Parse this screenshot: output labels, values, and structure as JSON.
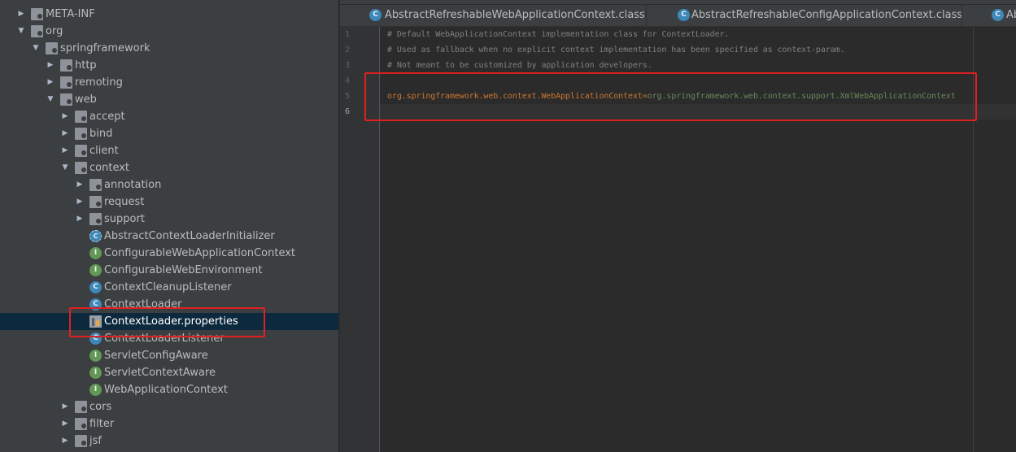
{
  "tree": {
    "items": [
      {
        "label": "META-INF",
        "indent": 0,
        "expanded": false,
        "icon": "folder-icon",
        "kind": "folder"
      },
      {
        "label": "org",
        "indent": 0,
        "expanded": true,
        "icon": "folder-icon",
        "kind": "folder"
      },
      {
        "label": "springframework",
        "indent": 1,
        "expanded": true,
        "icon": "folder-icon",
        "kind": "folder"
      },
      {
        "label": "http",
        "indent": 2,
        "expanded": false,
        "icon": "folder-icon",
        "kind": "folder"
      },
      {
        "label": "remoting",
        "indent": 2,
        "expanded": false,
        "icon": "folder-icon",
        "kind": "folder"
      },
      {
        "label": "web",
        "indent": 2,
        "expanded": true,
        "icon": "folder-icon",
        "kind": "folder"
      },
      {
        "label": "accept",
        "indent": 3,
        "expanded": false,
        "icon": "folder-icon",
        "kind": "folder"
      },
      {
        "label": "bind",
        "indent": 3,
        "expanded": false,
        "icon": "folder-icon",
        "kind": "folder"
      },
      {
        "label": "client",
        "indent": 3,
        "expanded": false,
        "icon": "folder-icon",
        "kind": "folder"
      },
      {
        "label": "context",
        "indent": 3,
        "expanded": true,
        "icon": "folder-icon",
        "kind": "folder"
      },
      {
        "label": "annotation",
        "indent": 4,
        "expanded": false,
        "icon": "folder-icon",
        "kind": "folder"
      },
      {
        "label": "request",
        "indent": 4,
        "expanded": false,
        "icon": "folder-icon",
        "kind": "folder"
      },
      {
        "label": "support",
        "indent": 4,
        "expanded": false,
        "icon": "folder-icon",
        "kind": "folder"
      },
      {
        "label": "AbstractContextLoaderInitializer",
        "indent": 4,
        "icon": "abstract-class-icon",
        "kind": "abstract"
      },
      {
        "label": "ConfigurableWebApplicationContext",
        "indent": 4,
        "icon": "interface-icon",
        "kind": "interface"
      },
      {
        "label": "ConfigurableWebEnvironment",
        "indent": 4,
        "icon": "interface-icon",
        "kind": "interface"
      },
      {
        "label": "ContextCleanupListener",
        "indent": 4,
        "icon": "class-icon",
        "kind": "class"
      },
      {
        "label": "ContextLoader",
        "indent": 4,
        "icon": "class-icon",
        "kind": "class"
      },
      {
        "label": "ContextLoader.properties",
        "indent": 4,
        "icon": "properties-file-icon",
        "kind": "properties",
        "selected": true
      },
      {
        "label": "ContextLoaderListener",
        "indent": 4,
        "icon": "class-icon",
        "kind": "class"
      },
      {
        "label": "ServletConfigAware",
        "indent": 4,
        "icon": "interface-icon",
        "kind": "interface"
      },
      {
        "label": "ServletContextAware",
        "indent": 4,
        "icon": "interface-icon",
        "kind": "interface"
      },
      {
        "label": "WebApplicationContext",
        "indent": 4,
        "icon": "interface-icon",
        "kind": "interface"
      },
      {
        "label": "cors",
        "indent": 3,
        "expanded": false,
        "icon": "folder-icon",
        "kind": "folder"
      },
      {
        "label": "filter",
        "indent": 3,
        "expanded": false,
        "icon": "folder-icon",
        "kind": "folder"
      },
      {
        "label": "jsf",
        "indent": 3,
        "expanded": false,
        "icon": "folder-icon",
        "kind": "folder"
      }
    ]
  },
  "tabs": [
    {
      "label": "AbstractRefreshableWebApplicationContext.class",
      "icon": "class-file-icon"
    },
    {
      "label": "AbstractRefreshableConfigApplicationContext.class",
      "icon": "class-file-icon"
    },
    {
      "label": "Ab",
      "icon": "class-file-icon"
    }
  ],
  "editor": {
    "line_numbers": [
      "1",
      "2",
      "3",
      "4",
      "5",
      "6"
    ],
    "lines": {
      "l1": "# Default WebApplicationContext implementation class for ContextLoader.",
      "l2": "# Used as fallback when no explicit context implementation has been specified as context-param.",
      "l3": "# Not meant to be customized by application developers.",
      "l5_key": "org.springframework.web.context.WebApplicationContext",
      "l5_eq": "=",
      "l5_value": "org.springframework.web.context.support.XmlWebApplicationContext"
    },
    "current_line": "6"
  },
  "colors": {
    "highlight_box": "#e02020",
    "selection": "#0d293e",
    "key": "#cc7832",
    "value": "#6a8759",
    "comment": "#808080"
  }
}
